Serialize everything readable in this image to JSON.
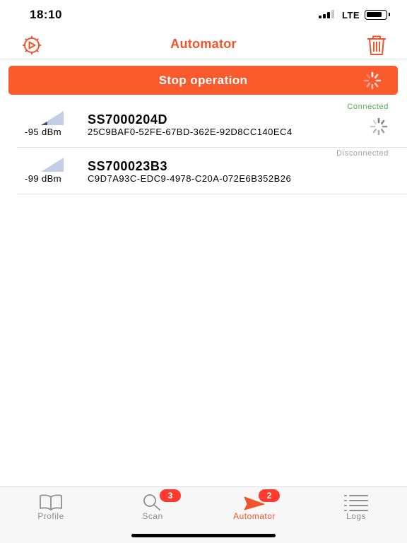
{
  "status_bar": {
    "time": "18:10",
    "network": "LTE"
  },
  "nav": {
    "title": "Automator",
    "left_icon": "gear-play-icon",
    "right_icon": "trash-icon"
  },
  "stop_button": {
    "label": "Stop operation",
    "spinner_icon": "spinner-icon"
  },
  "devices": [
    {
      "name": "SS7000204D",
      "uuid": "25C9BAF0-52FE-67BD-362E-92D8CC140EC4",
      "rssi": "-95 dBm",
      "status": "Connected",
      "status_color": "#4caf50"
    },
    {
      "name": "SS700023B3",
      "uuid": "C9D7A93C-EDC9-4978-C20A-072E6B352B26",
      "rssi": "-99 dBm",
      "status": "Disconnected",
      "status_color": "#a0a0a0"
    }
  ],
  "tabs": [
    {
      "label": "Profile",
      "icon": "book-icon",
      "badge": ""
    },
    {
      "label": "Scan",
      "icon": "magnifier-icon",
      "badge": "3"
    },
    {
      "label": "Automator",
      "icon": "play-arrow-icon",
      "badge": "2"
    },
    {
      "label": "Logs",
      "icon": "list-icon",
      "badge": ""
    }
  ],
  "colors": {
    "accent": "#f0542b",
    "button": "#fa5a2c",
    "badge": "#ff3b30",
    "signal": "#b8c6e0"
  }
}
